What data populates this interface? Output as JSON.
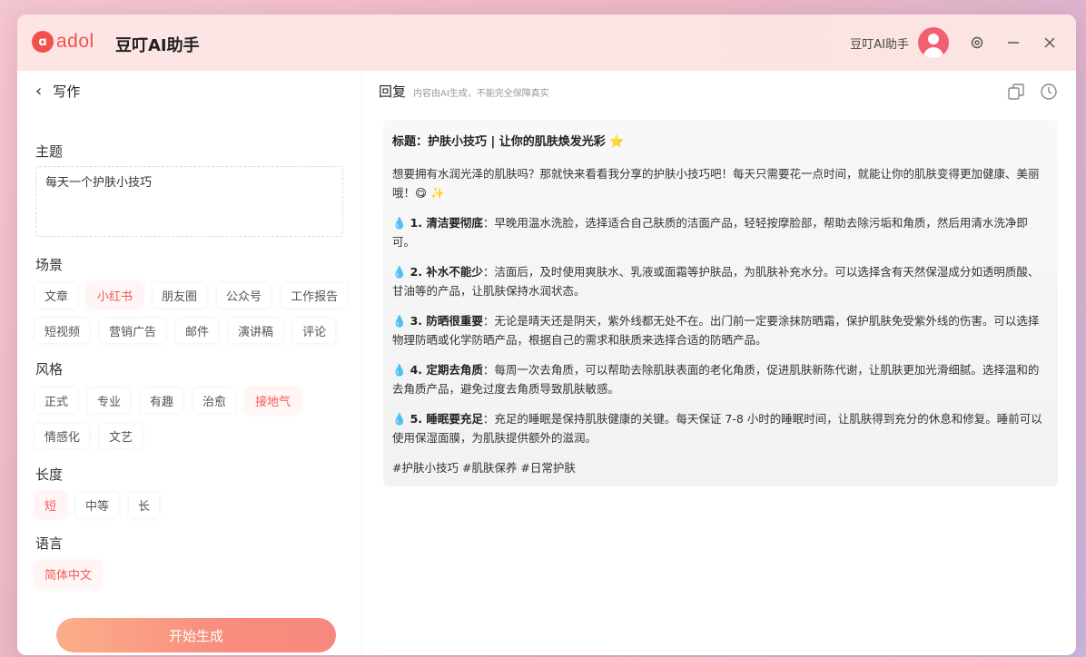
{
  "app": {
    "logo_mark": "ɑ",
    "logo_text": "adol",
    "title": "豆叮AI助手",
    "user_name": "豆叮AI助手"
  },
  "titlebar_icons": [
    "settings-icon",
    "minimize-icon",
    "close-icon"
  ],
  "left": {
    "back_label": "写作",
    "topic_label": "主题",
    "topic_value": "每天一个护肤小技巧",
    "scene_label": "场景",
    "scene_row1": [
      "文章",
      "小红书",
      "朋友圈",
      "公众号",
      "工作报告"
    ],
    "scene_row2": [
      "短视频",
      "营销广告",
      "邮件",
      "演讲稿",
      "评论"
    ],
    "scene_selected": "小红书",
    "style_label": "风格",
    "style_row1": [
      "正式",
      "专业",
      "有趣",
      "治愈",
      "接地气"
    ],
    "style_row2": [
      "情感化",
      "文艺"
    ],
    "style_selected": "接地气",
    "length_label": "长度",
    "length_options": [
      "短",
      "中等",
      "长"
    ],
    "length_selected": "短",
    "language_label": "语言",
    "language_options": [
      "简体中文"
    ],
    "language_selected": "简体中文",
    "generate_button": "开始生成"
  },
  "right": {
    "reply_title": "回复",
    "reply_note": "内容由AI生成，不能完全保障真实",
    "content": {
      "title": "标题：护肤小技巧 | 让你的肌肤焕发光彩 ⭐",
      "intro": "想要拥有水润光泽的肌肤吗？那就快来看看我分享的护肤小技巧吧！每天只需要花一点时间，就能让你的肌肤变得更加健康、美丽哦！😋 ✨",
      "tips": [
        {
          "head": "1. 清洁要彻底",
          "body": "：早晚用温水洗脸，选择适合自己肤质的洁面产品，轻轻按摩脸部，帮助去除污垢和角质，然后用清水洗净即可。"
        },
        {
          "head": "2. 补水不能少",
          "body": "：洁面后，及时使用爽肤水、乳液或面霜等护肤品，为肌肤补充水分。可以选择含有天然保湿成分如透明质酸、甘油等的产品，让肌肤保持水润状态。"
        },
        {
          "head": "3. 防晒很重要",
          "body": "：无论是晴天还是阴天，紫外线都无处不在。出门前一定要涂抹防晒霜，保护肌肤免受紫外线的伤害。可以选择物理防晒或化学防晒产品，根据自己的需求和肤质来选择合适的防晒产品。"
        },
        {
          "head": "4. 定期去角质",
          "body": "：每周一次去角质，可以帮助去除肌肤表面的老化角质，促进肌肤新陈代谢，让肌肤更加光滑细腻。选择温和的去角质产品，避免过度去角质导致肌肤敏感。"
        },
        {
          "head": "5. 睡眠要充足",
          "body": "：充足的睡眠是保持肌肤健康的关键。每天保证 7-8 小时的睡眠时间，让肌肤得到充分的休息和修复。睡前可以使用保湿面膜，为肌肤提供额外的滋润。"
        }
      ],
      "tags": "#护肤小技巧 #肌肤保养 #日常护肤"
    }
  },
  "colors": {
    "accent": "#f25b57",
    "button_gradient_start": "#fbae8a",
    "button_gradient_end": "#f5897e",
    "titlebar_bg": "#fde5e6"
  }
}
